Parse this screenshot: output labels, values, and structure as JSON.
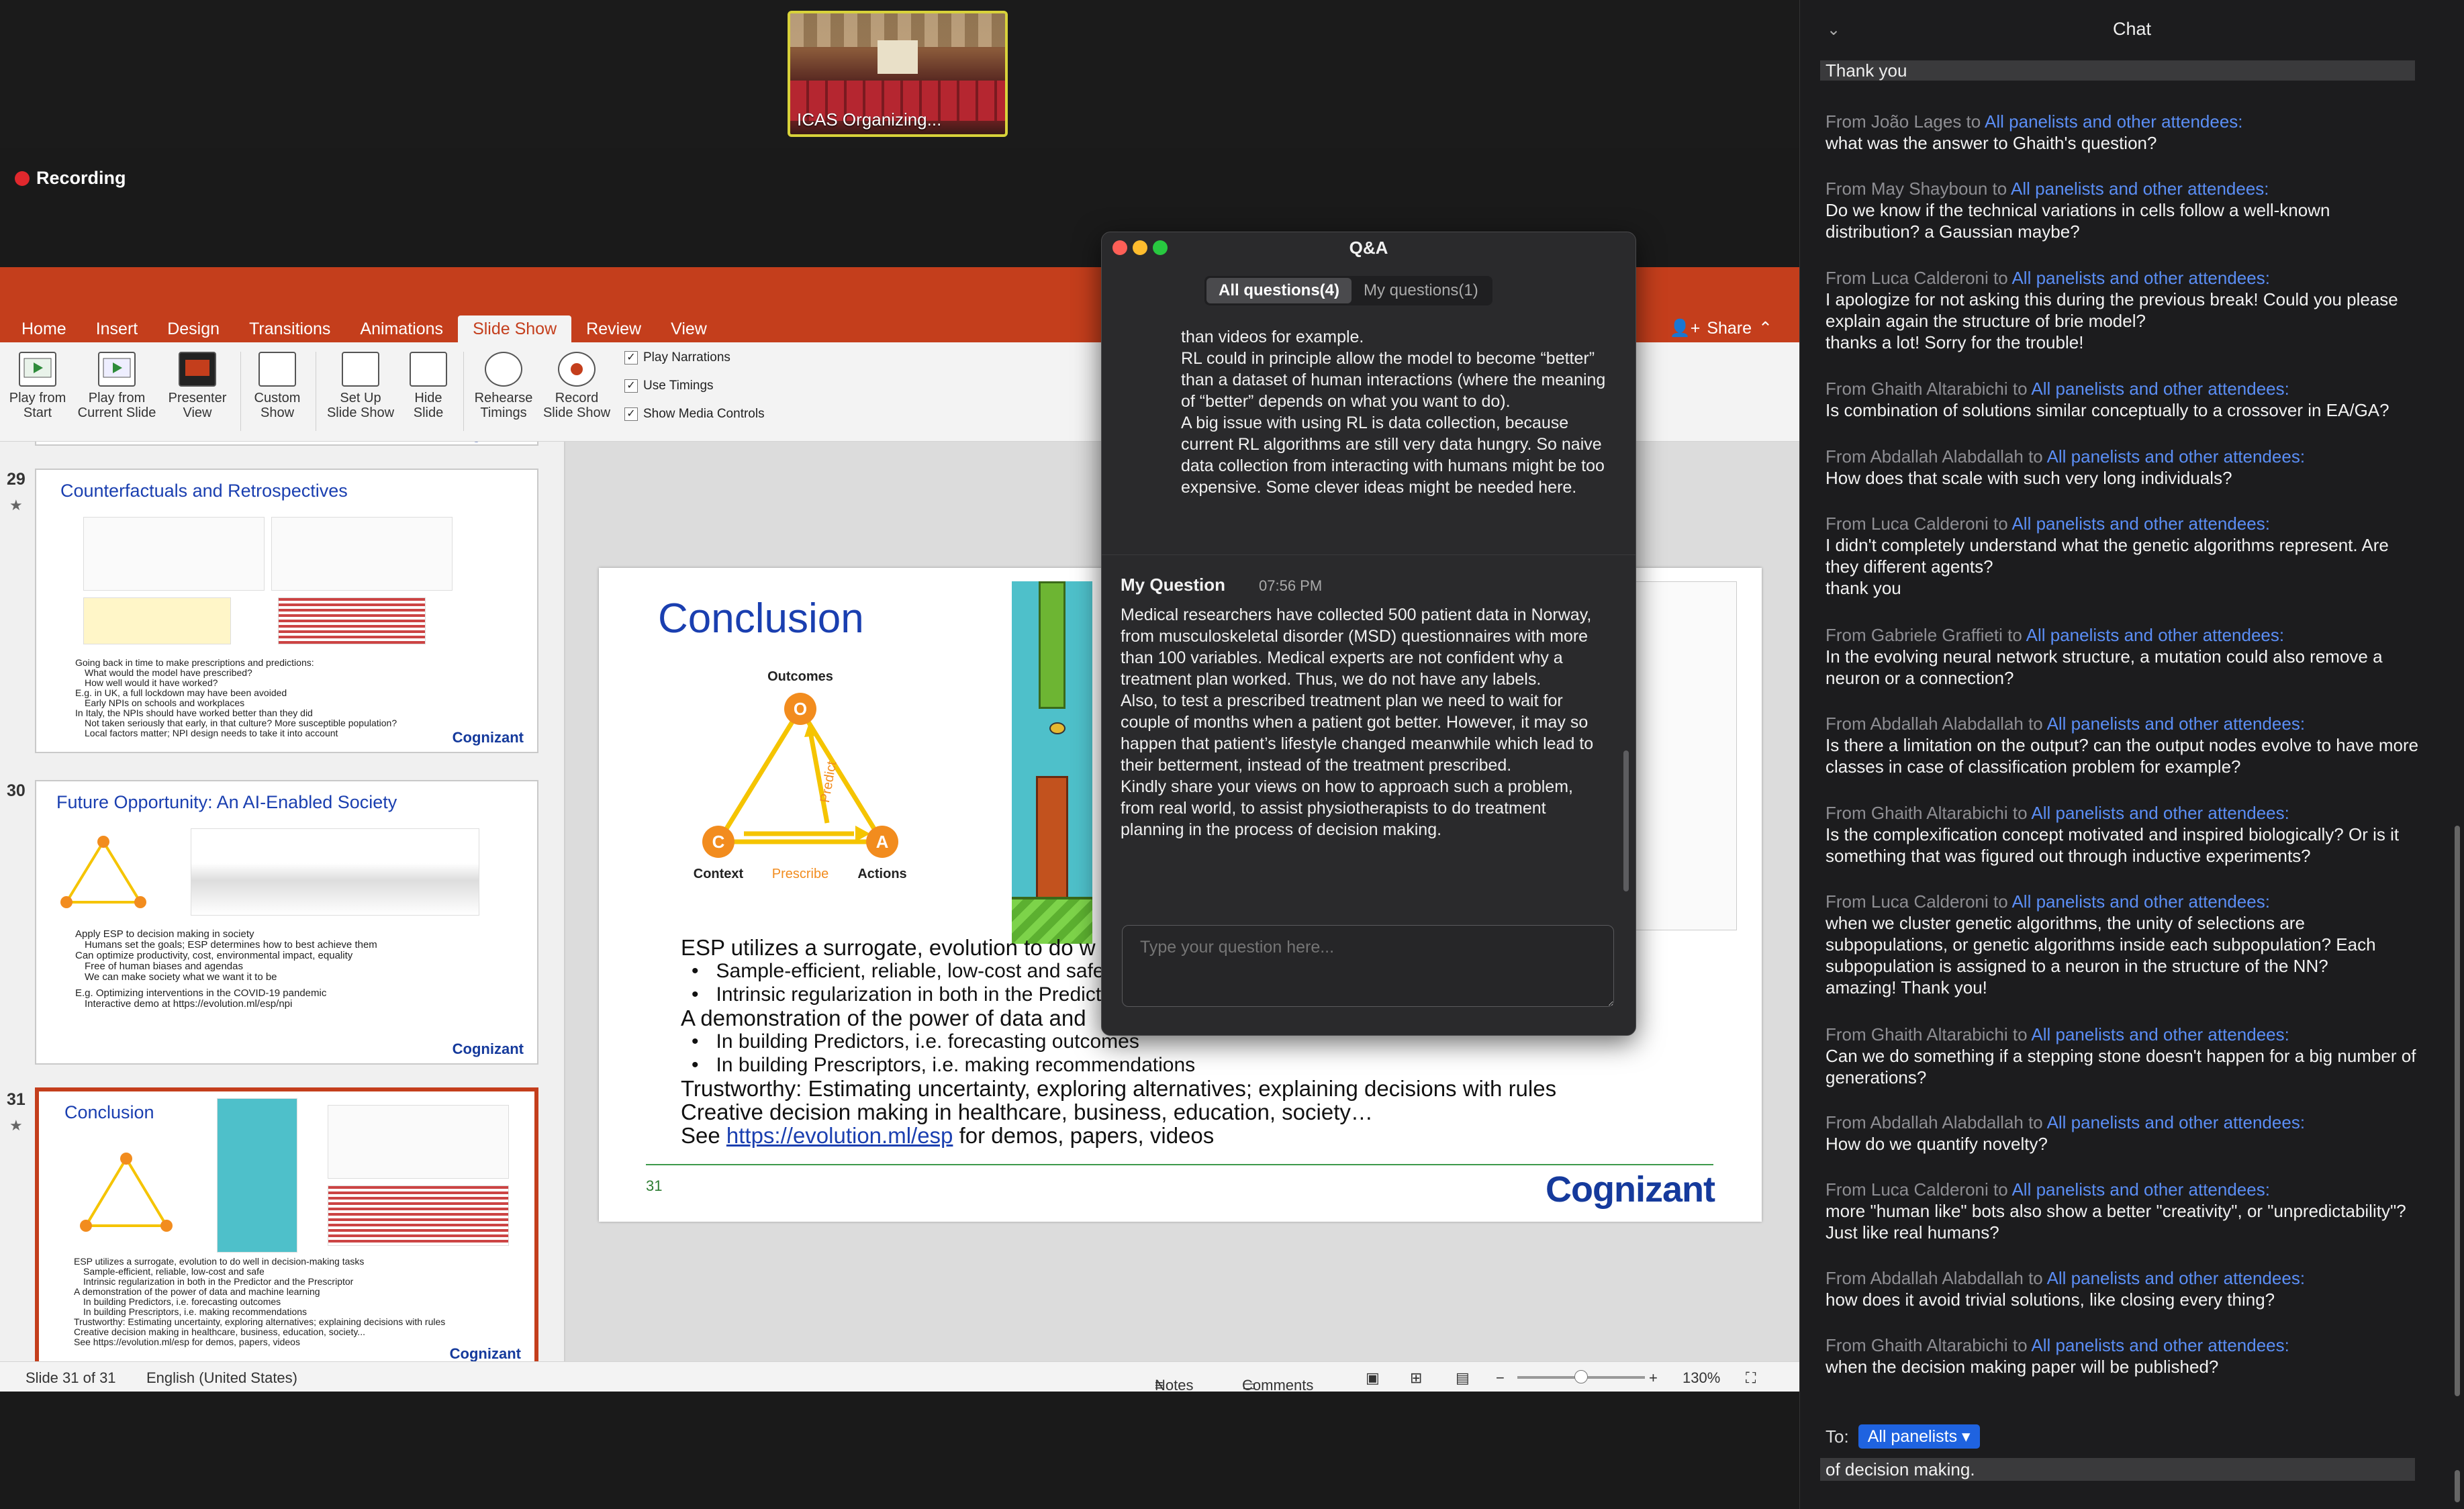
{
  "video": {
    "participant_name": "ICAS Organizing..."
  },
  "recording": {
    "label": "Recording"
  },
  "ppt": {
    "tabs": [
      "Home",
      "Insert",
      "Design",
      "Transitions",
      "Animations",
      "Slide Show",
      "Review",
      "View"
    ],
    "active_tab": "Slide Show",
    "share_label": "Share",
    "ribbon": {
      "play_from_start": "Play from\nStart",
      "play_from_current": "Play from\nCurrent Slide",
      "presenter_view": "Presenter\nView",
      "custom_show": "Custom\nShow",
      "set_up": "Set Up\nSlide Show",
      "hide_slide": "Hide\nSlide",
      "rehearse": "Rehearse\nTimings",
      "record": "Record\nSlide Show",
      "play_narrations": "Play Narrations",
      "use_timings": "Use Timings",
      "show_media_controls": "Show Media Controls"
    },
    "thumbnails": [
      {
        "num": "29",
        "title": "Counterfactuals and Retrospectives",
        "brand": "Cognizant",
        "text": [
          "Going back in time to make prescriptions and predictions:",
          "What would the model have prescribed?",
          "How well would it have worked?",
          "E.g. in UK, a full lockdown may have been avoided",
          "Early NPIs on schools and workplaces",
          "In Italy, the NPIs should have worked better than they did",
          "Not taken seriously that early, in that culture? More susceptible population?",
          "Local factors matter; NPI design needs to take it into account"
        ]
      },
      {
        "num": "30",
        "title": "Future Opportunity: An AI-Enabled Society",
        "brand": "Cognizant",
        "text": [
          "Apply ESP to decision making in society",
          "Humans set the goals; ESP determines how to best achieve them",
          "Can optimize productivity, cost, environmental impact, equality",
          "Free of human biases and agendas",
          "We can make society what we want it to be",
          "E.g. Optimizing interventions in the COVID-19 pandemic",
          "Interactive demo at https://evolution.ml/esp/npi"
        ]
      },
      {
        "num": "31",
        "title": "Conclusion",
        "brand": "Cognizant",
        "text": [
          "ESP utilizes a surrogate, evolution to do well in decision-making tasks",
          "Sample-efficient, reliable, low-cost and safe",
          "Intrinsic regularization in both in the Predictor and the Prescriptor",
          "A demonstration of the power of data and machine learning",
          "In building Predictors, i.e. forecasting outcomes",
          "In building Prescriptors, i.e. making recommendations",
          "Trustworthy: Estimating uncertainty, exploring alternatives; explaining decisions with rules",
          "Creative decision making in healthcare, business, education, society...",
          "See https://evolution.ml/esp for demos, papers, videos"
        ]
      }
    ],
    "slide": {
      "title": "Conclusion",
      "diagram": {
        "outcomes": "Outcomes",
        "o": "O",
        "c": "C",
        "a": "A",
        "context": "Context",
        "actions": "Actions",
        "prescribe": "Prescribe",
        "predict": "Predict"
      },
      "bullets": [
        {
          "level": 0,
          "text": "ESP utilizes a surrogate, evolution to do w"
        },
        {
          "level": 1,
          "text": "Sample-efficient, reliable, low-cost and safe"
        },
        {
          "level": 1,
          "text": "Intrinsic regularization in both in the Predicto"
        },
        {
          "level": 0,
          "text": "A demonstration of the power of data and"
        },
        {
          "level": 1,
          "text": "In building Predictors, i.e. forecasting outcomes"
        },
        {
          "level": 1,
          "text": "In building Prescriptors, i.e. making recommendations"
        },
        {
          "level": 0,
          "text": "Trustworthy: Estimating uncertainty, exploring alternatives; explaining decisions with rules"
        },
        {
          "level": 0,
          "text": "Creative decision making in healthcare, business, education, society…"
        }
      ],
      "see_prefix": "See ",
      "see_link": "https://evolution.ml/esp",
      "see_suffix": " for demos, papers, videos",
      "number": "31",
      "brand": "Cognizant"
    },
    "status": {
      "slide": "Slide 31 of 31",
      "language": "English (United States)",
      "notes": "Notes",
      "comments": "Comments",
      "zoom": "130%",
      "zoom_level": 0.5
    }
  },
  "qa": {
    "title": "Q&A",
    "tab_all": "All questions(4)",
    "tab_mine": "My questions(1)",
    "previous_answer": "than videos for example.\nRL could in principle allow the model to become “better” than a dataset of human interactions (where the meaning of “better” depends on what you want to do).\nA big issue with using RL is data collection, because current RL algorithms are still very data hungry. So naive data collection from interacting with humans might be too expensive. Some clever ideas might be needed here.",
    "my_question_label": "My Question",
    "my_question_time": "07:56 PM",
    "my_question": "Medical researchers have collected 500 patient data in Norway, from musculoskeletal disorder (MSD) questionnaires with more than 100 variables. Medical experts are not confident why a treatment plan worked. Thus, we do not have any labels.\nAlso, to test a prescribed treatment plan we need to wait for couple of months when a patient got better. However, it may so happen that patient’s lifestyle changed meanwhile which lead to their betterment, instead of the treatment prescribed.\nKindly share your views on how to approach such a problem, from real world, to assist physiotherapists to do treatment planning in the process of decision making.",
    "input_placeholder": "Type your question here..."
  },
  "chat": {
    "title": "Chat",
    "first": "Thank you",
    "messages": [
      {
        "from": "From João Lages to ",
        "to": "All panelists and other attendees:",
        "body": "what was the answer to Ghaith's question?"
      },
      {
        "from": "From May Shayboun to ",
        "to": "All panelists and other attendees:",
        "body": "Do we know if the technical variations in cells follow a well-known distribution? a Gaussian maybe?"
      },
      {
        "from": "From Luca Calderoni to ",
        "to": "All panelists and other attendees:",
        "body": "I apologize for not asking this during the previous break! Could you please explain again the structure of brie model?\nthanks a lot! Sorry for the trouble!"
      },
      {
        "from": "From Ghaith Altarabichi to ",
        "to": "All panelists and other attendees:",
        "body": "Is combination of solutions similar conceptually to a crossover in EA/GA?"
      },
      {
        "from": "From Abdallah Alabdallah to ",
        "to": "All panelists and other attendees:",
        "body": "How does that scale with such very long individuals?"
      },
      {
        "from": "From Luca Calderoni to ",
        "to": "All panelists and other attendees:",
        "body": "I didn't completely understand what the genetic algorithms represent. Are they different agents?\nthank you"
      },
      {
        "from": "From Gabriele Graffieti to ",
        "to": "All panelists and other attendees:",
        "body": "In the evolving neural network structure, a mutation could also remove a neuron or a connection?"
      },
      {
        "from": "From Abdallah Alabdallah to ",
        "to": "All panelists and other attendees:",
        "body": "Is there a limitation on the output? can the output nodes evolve to have more classes in case of classification problem for example?"
      },
      {
        "from": "From Ghaith Altarabichi to ",
        "to": "All panelists and other attendees:",
        "body": "Is the complexification concept motivated and inspired biologically? Or is it something that was figured out through inductive experiments?"
      },
      {
        "from": "From Luca Calderoni to ",
        "to": "All panelists and other attendees:",
        "body": "when we cluster genetic algorithms, the unity of selections are subpopulations, or genetic algorithms inside each subpopulation? Each subpopulation is assigned to a neuron in the structure of the NN?\namazing! Thank you!"
      },
      {
        "from": "From Ghaith Altarabichi to ",
        "to": "All panelists and other attendees:",
        "body": "Can we do something if a stepping stone doesn't happen for a big number of generations?"
      },
      {
        "from": "From Abdallah Alabdallah to ",
        "to": "All panelists and other attendees:",
        "body": "How do we quantify novelty?"
      },
      {
        "from": "From Luca Calderoni to ",
        "to": "All panelists and other attendees:",
        "body": "more \"human like\" bots also show a better \"creativity\", or \"unpredictability\"? Just like real humans?"
      },
      {
        "from": "From Abdallah Alabdallah to ",
        "to": "All panelists and other attendees:",
        "body": "how does it avoid trivial solutions, like closing every thing?"
      },
      {
        "from": "From Ghaith Altarabichi to ",
        "to": "All panelists and other attendees:",
        "body": "when the decision making paper will be published?"
      }
    ],
    "to_label": "To:",
    "recipient": "All panelists",
    "input_text": "of decision making."
  },
  "colors": {
    "ppt_red": "#c43e1c",
    "brand_blue": "#1a3fb0",
    "chat_link": "#5b8ef5",
    "diagram_orange": "#f28c1e",
    "diagram_yellow": "#f5c400"
  }
}
